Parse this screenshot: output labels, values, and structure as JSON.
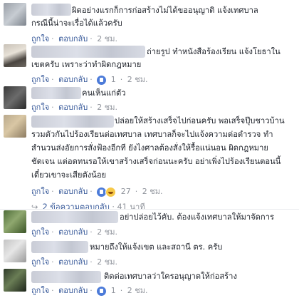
{
  "comments": [
    {
      "lines": [
        "ผิดอย่างแรกก็การก่อสร้างไม่ได้ขออนุญาติ แจ้งเทศบาล",
        "กรณีนี้น่าจะเรื่อได้แล้วครับ"
      ],
      "like_label": "ถูกใจ",
      "reply_label": "ตอบกลับ",
      "sep": "·",
      "time": "2 ชม."
    },
    {
      "lines": [
        "ถ่ายรูป ทำหนังสือร้องเรียน แจ้งโยธาใน",
        "เขตครับ เพราะว่าทำผิดกฎหมาย"
      ],
      "like_label": "ถูกใจ",
      "reply_label": "ตอบกลับ",
      "sep": "·",
      "reactions": "1",
      "time": "2 ชม."
    },
    {
      "lines": [
        "คนเห็นแก่ตัว"
      ],
      "like_label": "ถูกใจ",
      "reply_label": "ตอบกลับ",
      "sep": "·",
      "time": "2 ชม."
    },
    {
      "lines": [
        "ปล่อยให้สร้างเสร็จไปก่อนครับ พอเสร็จปุ๊บชาวบ้าน",
        "รวมตัวกันไปร้องเรียนต่อเทศบาล เทศบาลก็จะไปแจ้งความต่อตำรวจ ทำ",
        "สำนวนส่งอัยการสั่งฟ้องอีกที ยังไงศาลต้องสั่งให้รื้อแน่นอน ผิดกฎหมาย",
        "ชัดเจน แต่อดทนรอให้เขาสร้างเสร็จก่อนนะครับ อย่าเพิ่งไปร้องเรียนตอนนี้",
        "เดี๋ยวเขาจะเสียตังน้อย"
      ],
      "like_label": "ถูกใจ",
      "reply_label": "ตอบกลับ",
      "sep": "·",
      "reactions": "27",
      "time": "2 ชม.",
      "replies_label": "2 ข้อความตอบกลับ",
      "replies_time": "41 นาที"
    },
    {
      "lines": [
        "อย่าปล่อยไว้คับ. ต้องแจ้งเทศบาลให้มาจัดการ"
      ],
      "like_label": "ถูกใจ",
      "reply_label": "ตอบกลับ",
      "sep": "·",
      "time": "2 ชม."
    },
    {
      "lines": [
        "หมายถึงให้แจ้งเขต และสถานี ตร. ครับ"
      ],
      "like_label": "ถูกใจ",
      "reply_label": "ตอบกลับ",
      "sep": "·",
      "time": "2 ชม."
    },
    {
      "lines": [
        "ติดต่อเทศบาลว่าใครอนุญาตให้ก่อสร้าง"
      ],
      "like_label": "ถูกใจ",
      "reply_label": "ตอบกลับ",
      "sep": "·",
      "reactions": "1",
      "time": "2 ชม."
    }
  ],
  "colors": {
    "link": "#365899",
    "meta": "#90949c",
    "text": "#1d2129",
    "like": "#4c7bd9"
  }
}
